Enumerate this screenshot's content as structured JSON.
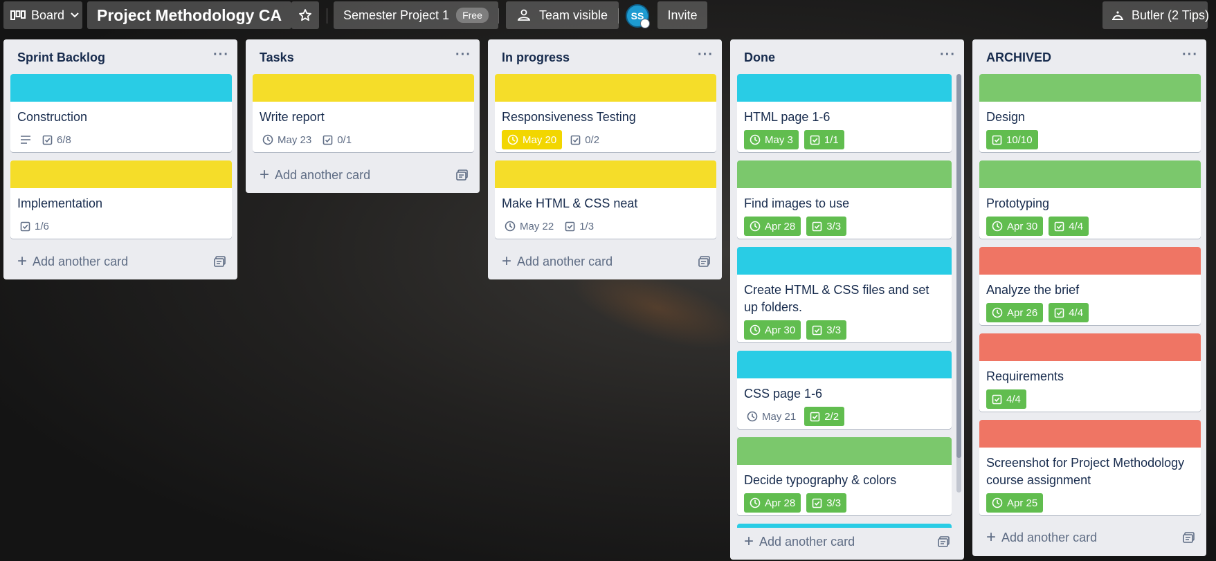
{
  "header": {
    "board_switcher_label": "Board",
    "board_title": "Project Methodology CA",
    "team_label": "Semester Project 1",
    "team_badge": "Free",
    "visibility_label": "Team visible",
    "avatar_initials": "SS",
    "invite_label": "Invite",
    "butler_label": "Butler (2 Tips)"
  },
  "colors": {
    "blue": "#29cce5",
    "yellow": "#f5dd29",
    "green": "#7bc86c",
    "red": "#ef7564",
    "due_green": "#61bd4f",
    "due_yellow": "#f2d600",
    "list_bg": "#ebecf0"
  },
  "lists": [
    {
      "name": "Sprint Backlog",
      "add_label": "Add another card",
      "cards": [
        {
          "cover": "blue",
          "title": "Construction",
          "has_description": true,
          "checklist": "6/8"
        },
        {
          "cover": "yellow",
          "title": "Implementation",
          "checklist": "1/6"
        }
      ]
    },
    {
      "name": "Tasks",
      "add_label": "Add another card",
      "cards": [
        {
          "cover": "yellow",
          "title": "Write report",
          "due": "May 23",
          "checklist": "0/1"
        }
      ]
    },
    {
      "name": "In progress",
      "add_label": "Add another card",
      "cards": [
        {
          "cover": "yellow",
          "title": "Responsiveness Testing",
          "due": "May 20",
          "due_status": "due-soon",
          "checklist": "0/2"
        },
        {
          "cover": "yellow",
          "title": "Make HTML & CSS neat",
          "due": "May 22",
          "checklist": "1/3"
        }
      ]
    },
    {
      "name": "Done",
      "add_label": "Add another card",
      "cards": [
        {
          "cover": "blue",
          "title": "HTML page 1-6",
          "due": "May 3",
          "due_status": "complete",
          "checklist": "1/1",
          "checklist_complete": true
        },
        {
          "cover": "green",
          "title": "Find images to use",
          "due": "Apr 28",
          "due_status": "complete",
          "checklist": "3/3",
          "checklist_complete": true
        },
        {
          "cover": "blue",
          "title": "Create HTML & CSS files and set up folders.",
          "due": "Apr 30",
          "due_status": "complete",
          "checklist": "3/3",
          "checklist_complete": true
        },
        {
          "cover": "blue",
          "title": "CSS page 1-6",
          "due": "May 21",
          "checklist": "2/2",
          "checklist_complete": true
        },
        {
          "cover": "green",
          "title": "Decide typography & colors",
          "due": "Apr 28",
          "due_status": "complete",
          "checklist": "3/3",
          "checklist_complete": true
        }
      ]
    },
    {
      "name": "ARCHIVED",
      "add_label": "Add another card",
      "cards": [
        {
          "cover": "green",
          "title": "Design",
          "checklist": "10/10",
          "checklist_complete": true
        },
        {
          "cover": "green",
          "title": "Prototyping",
          "due": "Apr 30",
          "due_status": "complete",
          "checklist": "4/4",
          "checklist_complete": true
        },
        {
          "cover": "red",
          "title": "Analyze the brief",
          "due": "Apr 26",
          "due_status": "complete",
          "checklist": "4/4",
          "checklist_complete": true
        },
        {
          "cover": "red",
          "title": "Requirements",
          "checklist": "4/4",
          "checklist_complete": true
        },
        {
          "cover": "red",
          "title": "Screenshot for Project Methodology course assignment",
          "due": "Apr 25",
          "due_status": "complete"
        }
      ]
    }
  ]
}
